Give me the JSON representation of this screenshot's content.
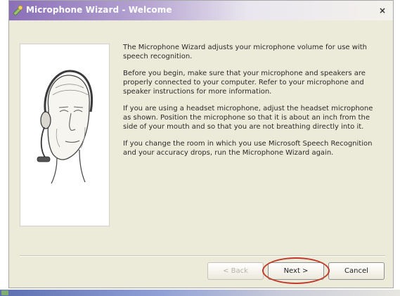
{
  "window": {
    "title": "Microphone Wizard - Welcome",
    "close_glyph": "×"
  },
  "icons": {
    "title_icon": "microphone-wizard-icon",
    "close_icon": "close-icon",
    "illustration": "headset-face-illustration"
  },
  "content": {
    "paragraphs": [
      "The Microphone Wizard adjusts your microphone volume for use with speech recognition.",
      "Before you begin, make sure that your microphone and speakers are properly connected to your computer. Refer to your microphone and speaker instructions for more information.",
      "If you are using a headset microphone, adjust the headset microphone as shown. Position the microphone so that it is about an inch from the side of your mouth and so that you are not breathing directly into it.",
      "If you change the room in which you use Microsoft Speech Recognition and your accuracy drops, run the Microphone Wizard again."
    ]
  },
  "buttons": {
    "back_label": "< Back",
    "next_label": "Next >",
    "cancel_label": "Cancel"
  },
  "colors": {
    "title_gradient_start": "#8a6fb8",
    "highlight": "#c0392b",
    "dialog_bg": "#ecead8"
  }
}
